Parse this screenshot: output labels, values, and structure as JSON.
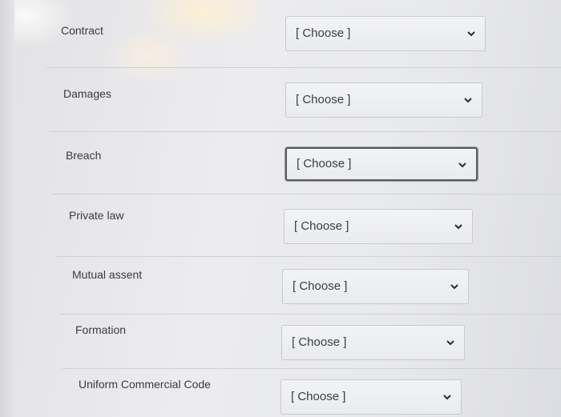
{
  "matching": {
    "rows": [
      {
        "term": "Contract",
        "selected": "[ Choose ]"
      },
      {
        "term": "Damages",
        "selected": "[ Choose ]"
      },
      {
        "term": "Breach",
        "selected": "[ Choose ]"
      },
      {
        "term": "Private law",
        "selected": "[ Choose ]"
      },
      {
        "term": "Mutual assent",
        "selected": "[ Choose ]"
      },
      {
        "term": "Formation",
        "selected": "[ Choose ]"
      },
      {
        "term": "Uniform Commercial Code",
        "selected": "[ Choose ]"
      }
    ],
    "focused_row_index": 2
  },
  "icons": {
    "dropdown": "chevron-down-icon"
  }
}
